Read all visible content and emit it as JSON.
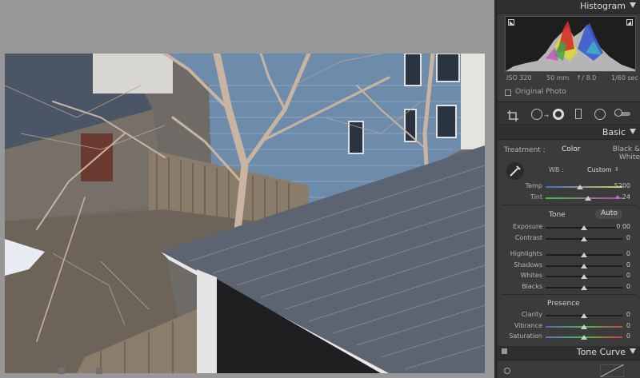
{
  "histogram": {
    "title": "Histogram",
    "iso": "ISO 320",
    "focal": "50 mm",
    "aperture": "f / 8.0",
    "shutter": "1/60 sec",
    "original_photo_label": "Original Photo"
  },
  "basic": {
    "title": "Basic",
    "treatment_label": "Treatment :",
    "treatment_color": "Color",
    "treatment_bw": "Black & White",
    "wb_label": "WB :",
    "wb_value": "Custom",
    "wb_arrows": "⇕",
    "sliders_wb": [
      {
        "label": "Temp",
        "value": "5200",
        "pos": 0.45
      },
      {
        "label": "Tint",
        "value": "+ 24",
        "pos": 0.55
      }
    ],
    "tone_label": "Tone",
    "auto_label": "Auto",
    "sliders_tone": [
      {
        "label": "Exposure",
        "value": "0.00",
        "pos": 0.5
      },
      {
        "label": "Contrast",
        "value": "0",
        "pos": 0.5
      }
    ],
    "sliders_tone2": [
      {
        "label": "Highlights",
        "value": "0",
        "pos": 0.5
      },
      {
        "label": "Shadows",
        "value": "0",
        "pos": 0.5
      },
      {
        "label": "Whites",
        "value": "0",
        "pos": 0.5
      },
      {
        "label": "Blacks",
        "value": "0",
        "pos": 0.5
      }
    ],
    "presence_label": "Presence",
    "sliders_presence": [
      {
        "label": "Clarity",
        "value": "0",
        "pos": 0.5
      },
      {
        "label": "Vibrance",
        "value": "0",
        "pos": 0.5
      },
      {
        "label": "Saturation",
        "value": "0",
        "pos": 0.5
      }
    ]
  },
  "tone_curve": {
    "title": "Tone Curve"
  },
  "colors": {
    "panel_bg": "#3b3b3b",
    "header_bg": "#2f2f2f",
    "canvas_bg": "#979797"
  },
  "icons": [
    "crop-overlay-icon",
    "spot-removal-icon",
    "red-eye-icon",
    "graduated-filter-icon",
    "radial-filter-icon",
    "adjustment-brush-icon",
    "white-balance-eyedropper-icon",
    "targeted-adjustment-icon"
  ]
}
